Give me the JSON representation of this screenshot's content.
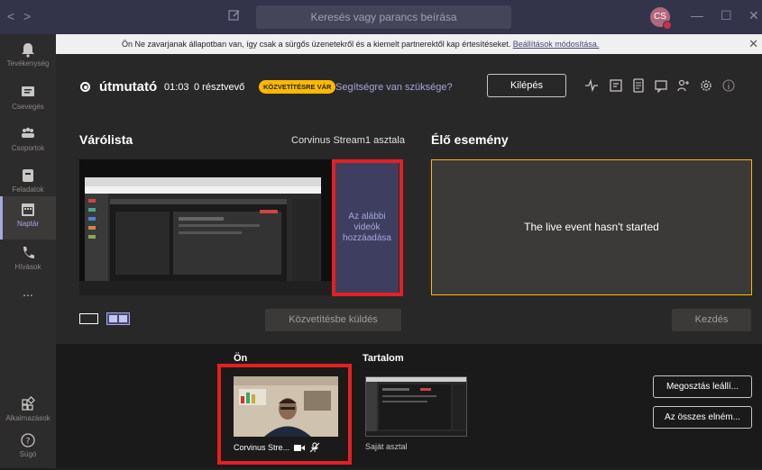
{
  "topbar": {
    "search_placeholder": "Keresés vagy parancs beírása",
    "avatar_initials": "CS",
    "nav_back": "<",
    "nav_forward": ">",
    "minimize": "—",
    "maximize": "☐",
    "close": "✕"
  },
  "rail": {
    "items": [
      {
        "label": "Tevékenység",
        "icon": "bell-icon"
      },
      {
        "label": "Csevegés",
        "icon": "chat-icon"
      },
      {
        "label": "Csoportok",
        "icon": "teams-icon"
      },
      {
        "label": "Feladatok",
        "icon": "assignments-icon"
      },
      {
        "label": "Naptár",
        "icon": "calendar-icon",
        "active": true
      },
      {
        "label": "Hívások",
        "icon": "phone-icon"
      },
      {
        "label": "...",
        "icon": "more-icon"
      },
      {
        "label": "Alkalmazások",
        "icon": "apps-icon"
      },
      {
        "label": "Súgó",
        "icon": "help-icon"
      }
    ]
  },
  "notification": {
    "text": "Ön Ne zavarjanak állapotban van, így csak a sürgős üzenetekről és a kiemelt partnerektől kap értesítéseket.",
    "link": "Beállítások módosítása.",
    "close": "✕"
  },
  "event": {
    "title": "útmutató",
    "time": "01:03",
    "participants": "0 résztvevő",
    "status_badge": "KÖZVETÍTÉSRE VÁR",
    "help_link": "Segítségre van szüksége?",
    "leave_button": "Kilépés"
  },
  "queue": {
    "title": "Várólista",
    "desk_name": "Corvinus Stream1 asztala",
    "add_label": "Az alábbi videók hozzáadása",
    "send_button": "Közvetítésbe küldés"
  },
  "live": {
    "title": "Élő esemény",
    "message": "The live event hasn't started",
    "start_button": "Kezdés"
  },
  "bottom": {
    "you_title": "Ön",
    "you_caption": "Corvinus Stre...",
    "content_title": "Tartalom",
    "content_caption": "Saját asztal",
    "stop_share_button": "Megosztás leállí...",
    "all_elements_button": "Az összes elném..."
  },
  "colors": {
    "accent": "#a6a7dc",
    "badge": "#ffb900",
    "highlight_frame": "#e52020",
    "background": "#292828"
  }
}
